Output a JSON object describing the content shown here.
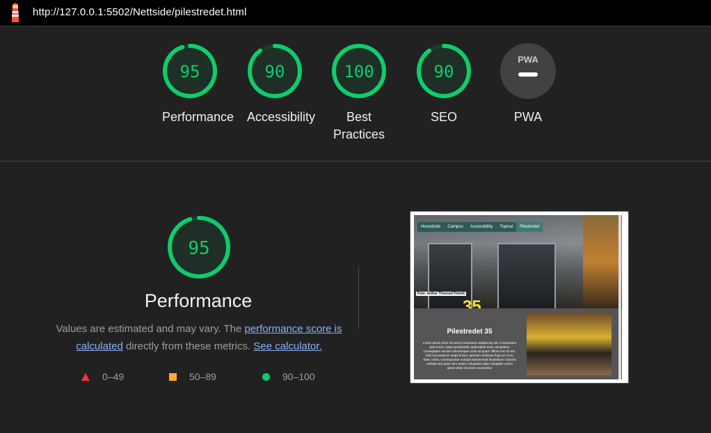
{
  "header": {
    "url": "http://127.0.0.1:5502/Nettside/pilestredet.html",
    "logo_icon": "lighthouse-icon"
  },
  "categories": [
    {
      "label": "Performance",
      "score": "95",
      "value": 95
    },
    {
      "label": "Accessibility",
      "score": "90",
      "value": 90
    },
    {
      "label": "Best Practices",
      "score": "100",
      "value": 100
    },
    {
      "label": "SEO",
      "score": "90",
      "value": 90
    },
    {
      "label": "PWA",
      "score": "",
      "value": null,
      "badge": "PWA"
    }
  ],
  "performance": {
    "score": "95",
    "value": 95,
    "title": "Performance",
    "desc_prefix": "Values are estimated and may vary. The ",
    "link_score": "performance score is calculated",
    "desc_middle": " directly from these metrics. ",
    "link_calculator": "See calculator.",
    "legend": [
      {
        "shape": "triangle",
        "range": "0–49",
        "color": "#ff3333"
      },
      {
        "shape": "square",
        "range": "50–89",
        "color": "#ffaa33"
      },
      {
        "shape": "circle",
        "range": "90–100",
        "color": "#0cce6b"
      }
    ]
  },
  "screenshot": {
    "nav": [
      "Hovedside",
      "Campus",
      "Accessibility",
      "Topical",
      "Pilestredet"
    ],
    "caption": "Foto: Arthur Thonrud Flotvik",
    "sign_number": "35",
    "heading": "Pilestredet 35",
    "body": "Lorem ipsum dolor sit amet consectetur adipisicing elit. Consectetur ipsa modi, magni perspiciatis quibusdam esse voluptatem consequatur veniam doloremque unde ad quam officiis non id rem. Odit accusantium sequi dolore, aperiam similique fuga vel. Eos, vitae, nobis, consequuntur suscipit assumenda laudantium corporis veritatis aut quae vero autem voluptates alias voluptate Lorem ipsum dolor sit amet consectetur"
  },
  "colors": {
    "pass": "#0cce6b",
    "average": "#ffaa33",
    "fail": "#ff3333",
    "background": "#212121"
  }
}
